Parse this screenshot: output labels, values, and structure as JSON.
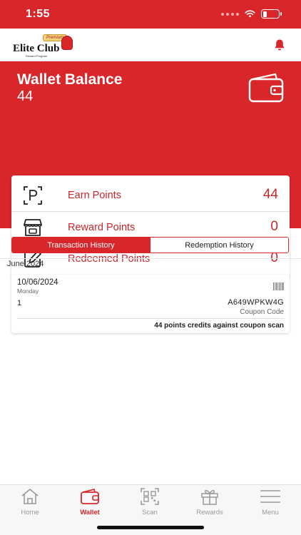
{
  "status_bar": {
    "time": "1:55"
  },
  "header": {
    "logo_text": "Elite Club",
    "logo_badge": "Premium",
    "logo_subtext": "Reward Program"
  },
  "wallet": {
    "title": "Wallet Balance",
    "balance": "44"
  },
  "points": [
    {
      "label": "Earn Points",
      "value": "44",
      "icon": "parking-p-icon"
    },
    {
      "label": "Reward Points",
      "value": "0",
      "icon": "store-icon"
    },
    {
      "label": "Redeemed Points",
      "value": "0",
      "icon": "edit-icon"
    }
  ],
  "tabs": [
    {
      "label": "Transaction History",
      "active": true
    },
    {
      "label": "Redemption History",
      "active": false
    }
  ],
  "history": {
    "month": "June 2024",
    "transactions": [
      {
        "date": "10/06/2024",
        "day": "Monday",
        "quantity": "1",
        "code": "A649WPKW4G",
        "code_label": "Coupon Code",
        "note": "44 points credits against coupon scan"
      }
    ]
  },
  "bottom_nav": [
    {
      "label": "Home",
      "icon": "home-icon",
      "active": false
    },
    {
      "label": "Wallet",
      "icon": "wallet-icon",
      "active": true
    },
    {
      "label": "Scan",
      "icon": "qr-scan-icon",
      "active": false
    },
    {
      "label": "Rewards",
      "icon": "gift-icon",
      "active": false
    },
    {
      "label": "Menu",
      "icon": "hamburger-menu-icon",
      "active": false
    }
  ],
  "colors": {
    "brand_red": "#d8262b",
    "text_red": "#c8262b",
    "inactive_nav": "#999999"
  }
}
